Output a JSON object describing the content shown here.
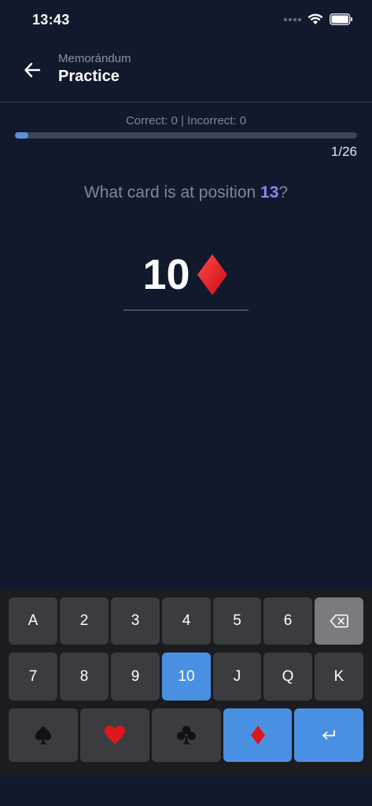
{
  "status": {
    "time": "13:43"
  },
  "header": {
    "subtitle": "Memorándum",
    "title": "Practice"
  },
  "score_text": "Correct: 0 | Incorrect: 0",
  "progress": {
    "fraction": 0.0385,
    "counter": "1/26"
  },
  "question": {
    "prefix": "What card is at position ",
    "position": "13",
    "suffix": "?"
  },
  "answer": {
    "rank": "10",
    "suit": "diamonds"
  },
  "keyboard": {
    "row1": [
      "A",
      "2",
      "3",
      "4",
      "5",
      "6"
    ],
    "row2": [
      "7",
      "8",
      "9",
      "10",
      "J",
      "Q",
      "K"
    ],
    "suits": [
      "spades",
      "hearts",
      "clubs",
      "diamonds"
    ],
    "selected_rank": "10",
    "selected_suit": "diamonds"
  },
  "colors": {
    "background": "#111a2c",
    "accent": "#4a90e2",
    "position_highlight": "#7f8ff0",
    "diamond_red": "#e0161e"
  }
}
